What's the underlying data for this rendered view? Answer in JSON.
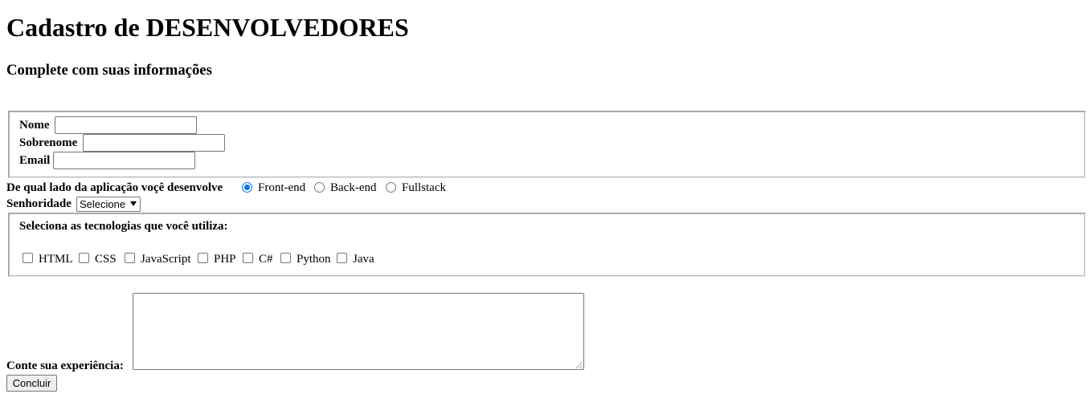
{
  "header": {
    "title": "Cadastro de DESENVOLVEDORES",
    "subtitle": "Complete com suas informações"
  },
  "personal": {
    "name_label": "Nome",
    "name_value": "",
    "surname_label": "Sobrenome",
    "surname_value": "",
    "email_label": "Email",
    "email_value": ""
  },
  "side": {
    "question": "De qual lado da aplicação voçê desenvolve",
    "options": [
      {
        "label": "Front-end",
        "checked": true
      },
      {
        "label": "Back-end",
        "checked": false
      },
      {
        "label": "Fullstack",
        "checked": false
      }
    ]
  },
  "seniority": {
    "label": "Senhoridade",
    "selected": "Selecione"
  },
  "technologies": {
    "heading": "Seleciona as tecnologias que você utiliza:",
    "items": [
      {
        "label": "HTML",
        "checked": false
      },
      {
        "label": "CSS",
        "checked": false
      },
      {
        "label": "JavaScript",
        "checked": false
      },
      {
        "label": "PHP",
        "checked": false
      },
      {
        "label": "C#",
        "checked": false
      },
      {
        "label": "Python",
        "checked": false
      },
      {
        "label": "Java",
        "checked": false
      }
    ]
  },
  "experience": {
    "label": "Conte sua experiência:",
    "value": ""
  },
  "submit": {
    "label": "Concluir"
  },
  "colors": {
    "accent": "#0075ff",
    "border": "#767676",
    "button_bg": "#efefef"
  }
}
